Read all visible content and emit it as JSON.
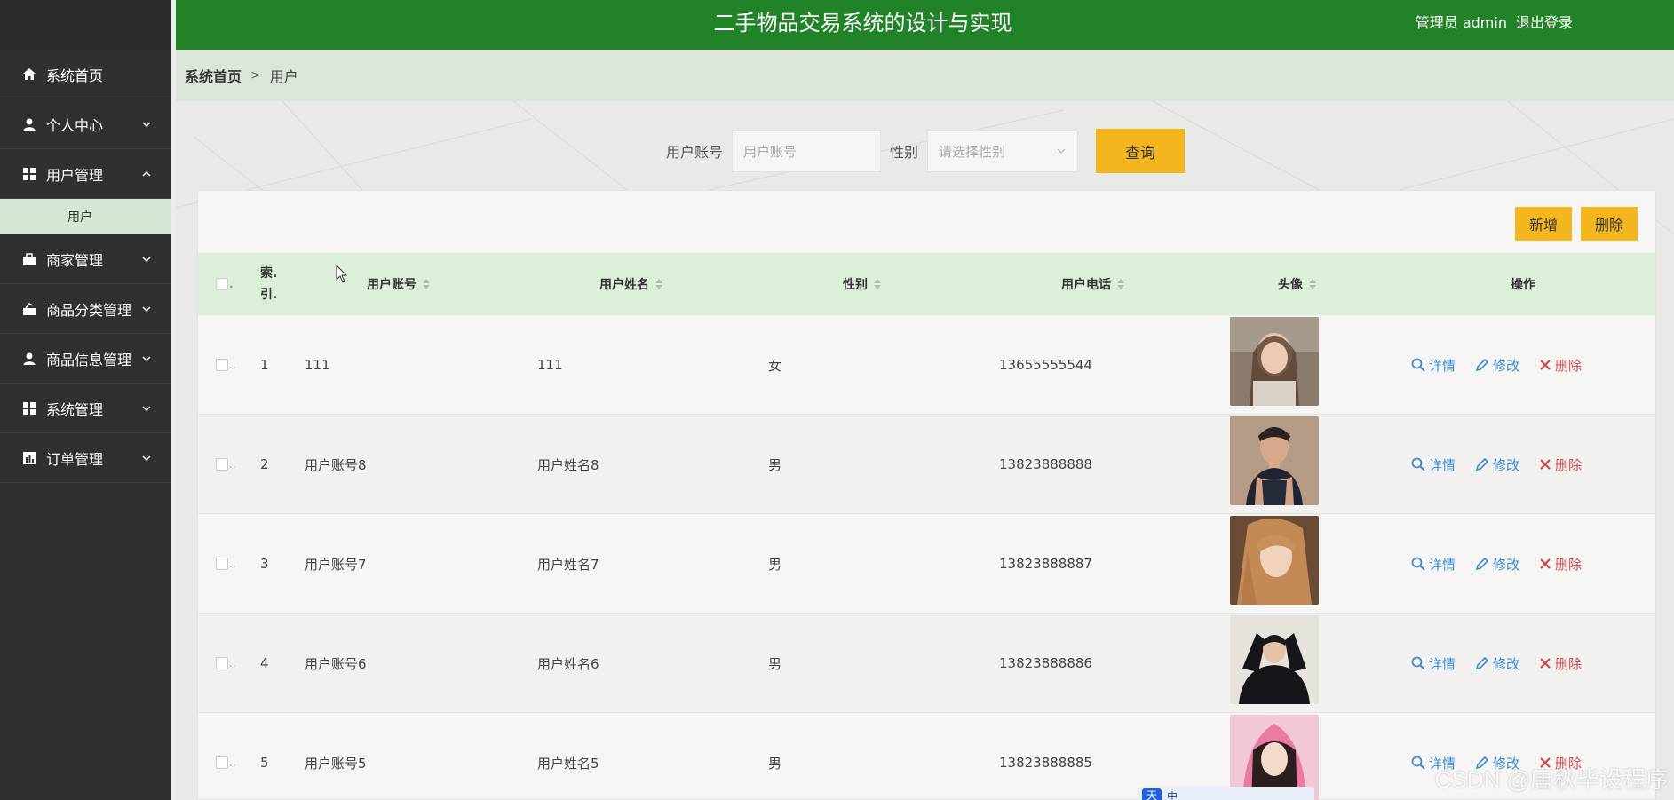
{
  "app": {
    "title": "二手物品交易系统的设计与实现",
    "user_label": "管理员 admin",
    "logout": "退出登录"
  },
  "sidebar": {
    "items": [
      {
        "label": "系统首页",
        "icon": "home-icon"
      },
      {
        "label": "个人中心",
        "icon": "person-icon"
      },
      {
        "label": "用户管理",
        "icon": "grid-icon"
      },
      {
        "label": "商家管理",
        "icon": "briefcase-icon"
      },
      {
        "label": "商品分类管理",
        "icon": "category-icon"
      },
      {
        "label": "商品信息管理",
        "icon": "person-icon"
      },
      {
        "label": "系统管理",
        "icon": "grid-icon"
      },
      {
        "label": "订单管理",
        "icon": "chart-icon"
      }
    ],
    "subitem": "用户"
  },
  "breadcrumb": {
    "home": "系统首页",
    "sep": ">",
    "current": "用户"
  },
  "search": {
    "account_label": "用户账号",
    "account_placeholder": "用户账号",
    "gender_label": "性别",
    "gender_placeholder": "请选择性别",
    "query_button": "查询"
  },
  "actions": {
    "add": "新增",
    "delete": "删除"
  },
  "table": {
    "headers": {
      "index": "索.引.",
      "account": "用户账号",
      "name": "用户姓名",
      "gender": "性别",
      "phone": "用户电话",
      "avatar": "头像",
      "ops": "操作"
    },
    "op_labels": {
      "detail": "详情",
      "edit": "修改",
      "delete": "删除"
    },
    "rows": [
      {
        "index": "1",
        "account": "111",
        "name": "111",
        "gender": "女",
        "phone": "13655555544"
      },
      {
        "index": "2",
        "account": "用户账号8",
        "name": "用户姓名8",
        "gender": "男",
        "phone": "13823888888"
      },
      {
        "index": "3",
        "account": "用户账号7",
        "name": "用户姓名7",
        "gender": "男",
        "phone": "13823888887"
      },
      {
        "index": "4",
        "account": "用户账号6",
        "name": "用户姓名6",
        "gender": "男",
        "phone": "13823888886"
      },
      {
        "index": "5",
        "account": "用户账号5",
        "name": "用户姓名5",
        "gender": "男",
        "phone": "13823888885"
      }
    ]
  },
  "watermark": "CSDN @唐秋毕设程序",
  "ime": {
    "logo": "天",
    "mode": "中"
  },
  "colors": {
    "header": "#218227",
    "sidebar": "#2f3030",
    "accent": "#f3b61f",
    "table_head": "#dcefd9"
  }
}
